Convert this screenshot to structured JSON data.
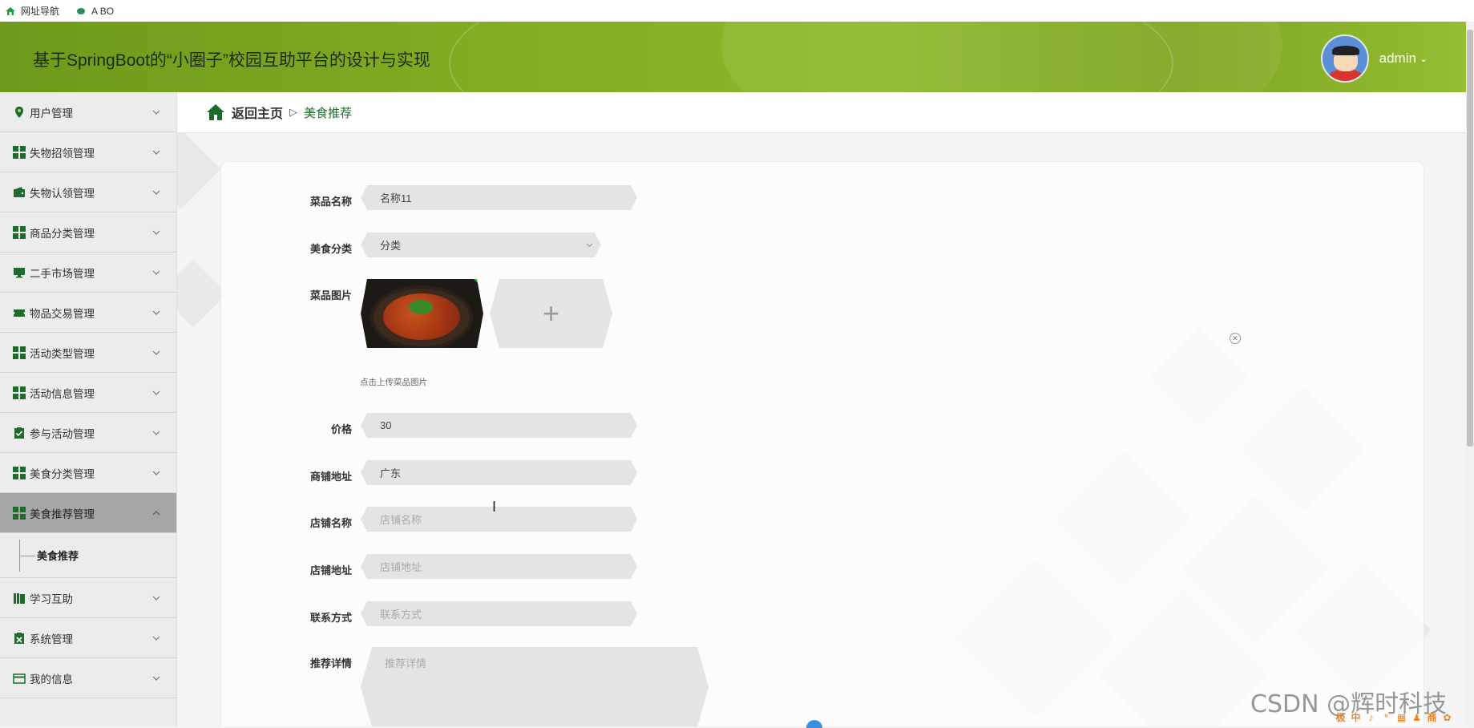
{
  "bookmarks": [
    {
      "label": "网址导航",
      "icon": "home-green-icon"
    },
    {
      "label": "A BO",
      "icon": "leaf-icon"
    }
  ],
  "header": {
    "title": "基于SpringBoot的“小圈子”校园互助平台的设计与实现",
    "user": "admin"
  },
  "sidebar": {
    "items": [
      {
        "label": "用户管理",
        "icon": "map-pin-icon"
      },
      {
        "label": "失物招领管理",
        "icon": "grid-icon"
      },
      {
        "label": "失物认领管理",
        "icon": "wallet-icon"
      },
      {
        "label": "商品分类管理",
        "icon": "grid-icon"
      },
      {
        "label": "二手市场管理",
        "icon": "monitor-icon"
      },
      {
        "label": "物品交易管理",
        "icon": "ticket-icon"
      },
      {
        "label": "活动类型管理",
        "icon": "grid-icon"
      },
      {
        "label": "活动信息管理",
        "icon": "grid-icon"
      },
      {
        "label": "参与活动管理",
        "icon": "clipboard-check-icon"
      },
      {
        "label": "美食分类管理",
        "icon": "grid-icon"
      },
      {
        "label": "美食推荐管理",
        "icon": "grid-icon"
      }
    ],
    "sub_item": "美食推荐",
    "items_after": [
      {
        "label": "学习互助",
        "icon": "books-icon"
      },
      {
        "label": "系统管理",
        "icon": "clipboard-x-icon"
      },
      {
        "label": "我的信息",
        "icon": "id-card-icon"
      }
    ]
  },
  "breadcrumb": {
    "home": "返回主页",
    "separator": "▷",
    "current": "美食推荐"
  },
  "form": {
    "dish_name": {
      "label": "菜品名称",
      "value": "名称11"
    },
    "category": {
      "label": "美食分类",
      "value": "分类"
    },
    "image": {
      "label": "菜品图片",
      "hint": "点击上传菜品图片",
      "add": "+"
    },
    "price": {
      "label": "价格",
      "value": "30"
    },
    "shop_address": {
      "label": "商铺地址",
      "value": "广东"
    },
    "store_name": {
      "label": "店铺名称",
      "placeholder": "店铺名称"
    },
    "store_address": {
      "label": "店铺地址",
      "placeholder": "店铺地址"
    },
    "contact": {
      "label": "联系方式",
      "placeholder": "联系方式"
    },
    "details": {
      "label": "推荐详情",
      "placeholder": "推荐详情"
    }
  },
  "watermark": "CSDN @辉时科技",
  "tray": [
    "极",
    "中",
    "♪",
    "°",
    "▦",
    "♟",
    "商",
    "✿"
  ],
  "colors": {
    "accent": "#1f6b2e",
    "header": "#84ad22"
  }
}
